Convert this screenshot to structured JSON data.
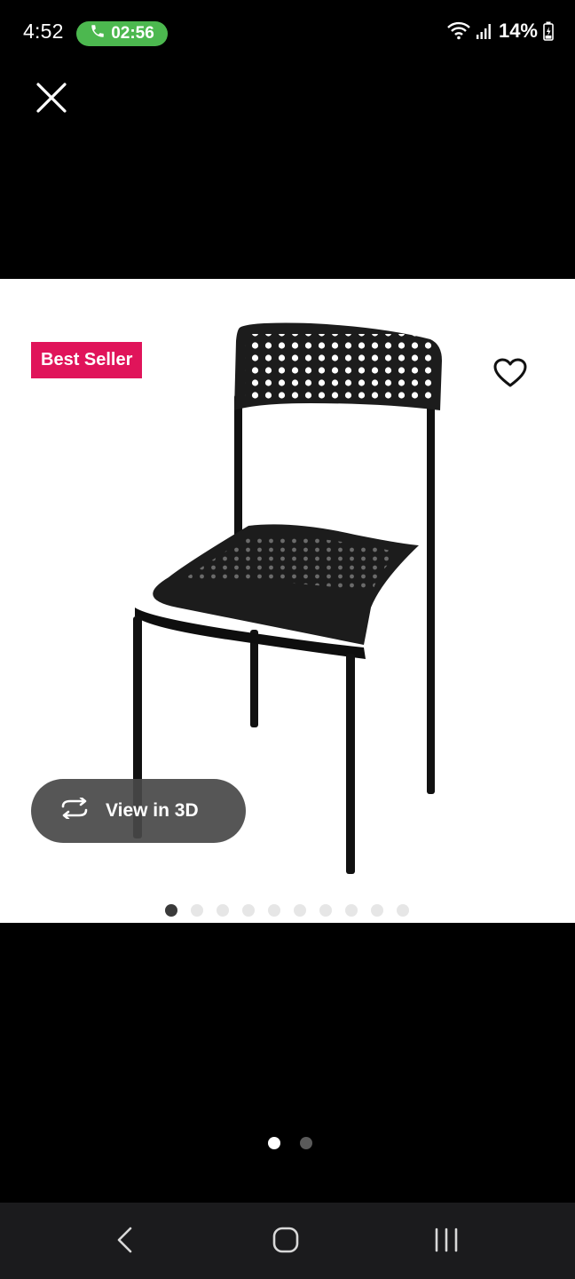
{
  "status_bar": {
    "time": "4:52",
    "call_timer": "02:56",
    "battery_percent": "14%",
    "icons": [
      "phone-icon",
      "wifi-icon",
      "signal-icon",
      "battery-charging-icon"
    ]
  },
  "viewer": {
    "close_icon": "close-icon",
    "badge_label": "Best Seller",
    "favorite_icon": "heart-outline-icon",
    "view_3d_label": "View in 3D",
    "view_3d_icon": "rotate-icon",
    "product_image": "black-stacking-chair",
    "carousel": {
      "total": 10,
      "active_index": 0
    },
    "pager": {
      "total": 2,
      "active_index": 0
    }
  },
  "nav_bar": {
    "icons": [
      "back-icon",
      "home-icon",
      "recents-icon"
    ]
  },
  "colors": {
    "badge": "#e0145a",
    "call_pill": "#4cb84f",
    "nav_bar": "#1b1b1d"
  }
}
